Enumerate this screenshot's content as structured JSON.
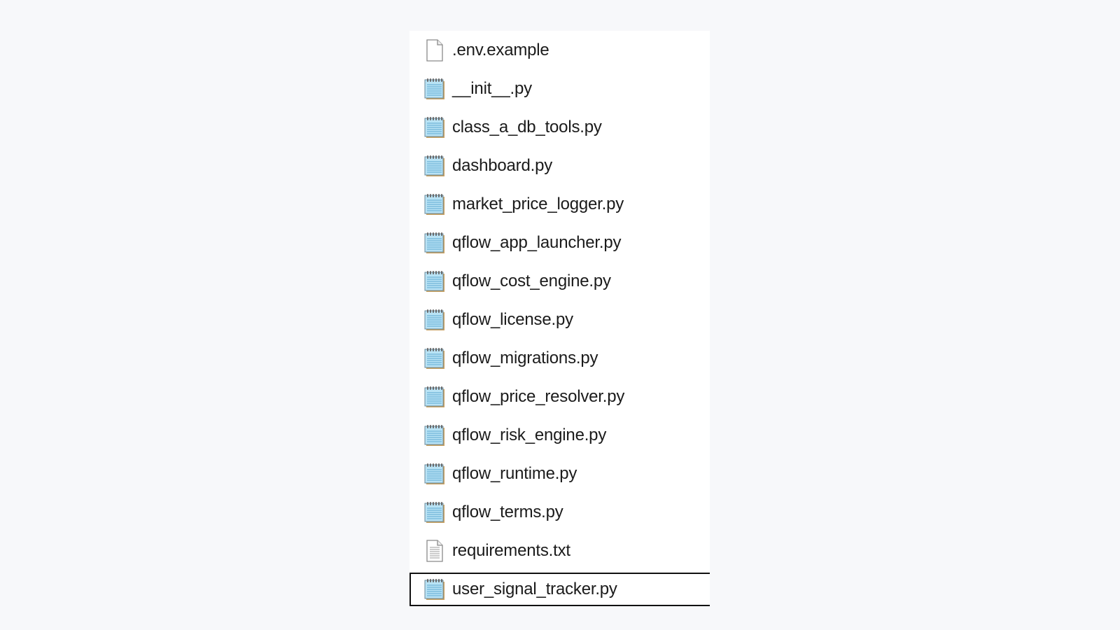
{
  "files": [
    {
      "name": ".env.example",
      "icon": "blank-file-icon"
    },
    {
      "name": "__init__.py",
      "icon": "python-file-icon"
    },
    {
      "name": "class_a_db_tools.py",
      "icon": "python-file-icon"
    },
    {
      "name": "dashboard.py",
      "icon": "python-file-icon"
    },
    {
      "name": "market_price_logger.py",
      "icon": "python-file-icon"
    },
    {
      "name": "qflow_app_launcher.py",
      "icon": "python-file-icon"
    },
    {
      "name": "qflow_cost_engine.py",
      "icon": "python-file-icon"
    },
    {
      "name": "qflow_license.py",
      "icon": "python-file-icon"
    },
    {
      "name": "qflow_migrations.py",
      "icon": "python-file-icon"
    },
    {
      "name": "qflow_price_resolver.py",
      "icon": "python-file-icon"
    },
    {
      "name": "qflow_risk_engine.py",
      "icon": "python-file-icon"
    },
    {
      "name": "qflow_runtime.py",
      "icon": "python-file-icon"
    },
    {
      "name": "qflow_terms.py",
      "icon": "python-file-icon"
    },
    {
      "name": "requirements.txt",
      "icon": "text-file-icon"
    },
    {
      "name": "user_signal_tracker.py",
      "icon": "python-file-icon",
      "selected": true
    }
  ],
  "colors": {
    "background": "#f7f8fa",
    "panel": "#ffffff",
    "text": "#1b1b1b",
    "notepad_blue": "#a8d8f0",
    "selection_border": "#111111"
  }
}
